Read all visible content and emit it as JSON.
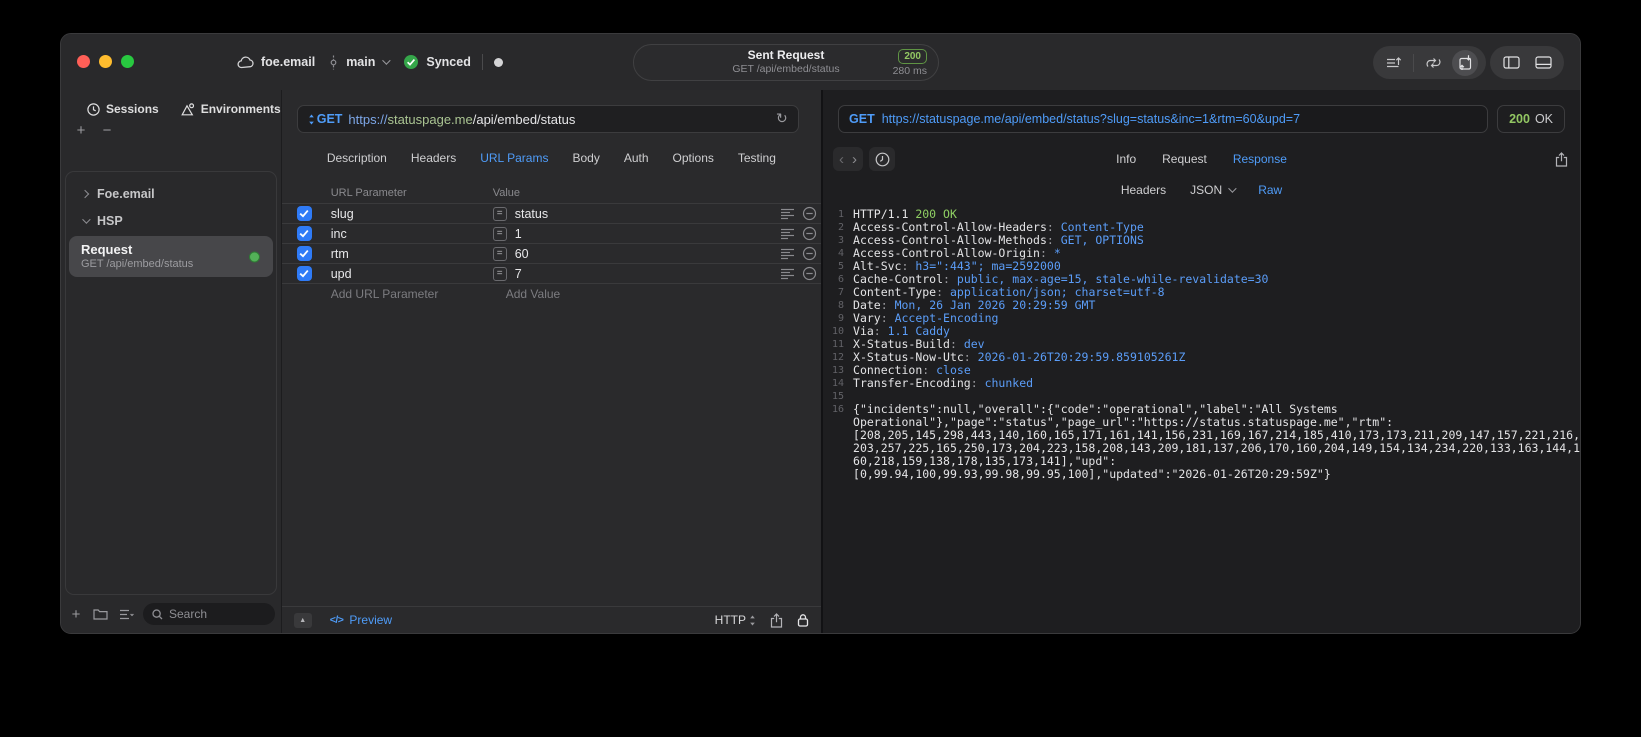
{
  "titlebar": {
    "project_name": "foe.email",
    "branch_name": "main",
    "sync_label": "Synced",
    "request_pill": {
      "title": "Sent Request",
      "subtitle": "GET /api/embed/status",
      "status_code": "200",
      "duration": "280 ms"
    }
  },
  "sidebar": {
    "tabs": [
      {
        "label": "Sessions",
        "icon": "clock-icon"
      },
      {
        "label": "Environments",
        "icon": "environments-icon"
      }
    ],
    "add_button": "+",
    "remove_button": "−",
    "tree": [
      {
        "label": "Foe.email",
        "expanded": false
      },
      {
        "label": "HSP",
        "expanded": true
      }
    ],
    "request_item": {
      "title": "Request",
      "subtitle": "GET /api/embed/status",
      "status_color": "#53b158"
    },
    "search": {
      "placeholder": "Search"
    }
  },
  "editor": {
    "method": "GET",
    "url": {
      "scheme": "https://",
      "host": "statuspage.me",
      "path": "/api/embed/status"
    },
    "tabs": [
      "Description",
      "Headers",
      "URL Params",
      "Body",
      "Auth",
      "Options",
      "Testing"
    ],
    "active_tab": "URL Params",
    "params": {
      "columns": [
        "URL Parameter",
        "Value"
      ],
      "rows": [
        {
          "checked": true,
          "name": "slug",
          "value": "status"
        },
        {
          "checked": true,
          "name": "inc",
          "value": "1"
        },
        {
          "checked": true,
          "name": "rtm",
          "value": "60"
        },
        {
          "checked": true,
          "name": "upd",
          "value": "7"
        }
      ],
      "add_row": {
        "name_placeholder": "Add URL Parameter",
        "value_placeholder": "Add Value"
      }
    },
    "footer": {
      "preview_label": "Preview",
      "code_glyph": "</>",
      "protocol": "HTTP"
    }
  },
  "response": {
    "request_line": {
      "method": "GET",
      "url": "https://statuspage.me/api/embed/status?slug=status&inc=1&rtm=60&upd=7"
    },
    "status": {
      "code": "200",
      "text": "OK"
    },
    "tabs": [
      "Info",
      "Request",
      "Response"
    ],
    "active_tab": "Response",
    "subtabs": [
      "Headers",
      "JSON",
      "Raw"
    ],
    "active_subtab": "Raw",
    "body_lines": [
      {
        "parts": [
          {
            "t": "HTTP/1.1 ",
            "s": "plain"
          },
          {
            "t": "200 OK",
            "s": "green"
          }
        ]
      },
      {
        "parts": [
          {
            "t": "Access-Control-Allow-Headers",
            "s": "plain"
          },
          {
            "t": ": ",
            "s": "muted"
          },
          {
            "t": "Content-Type",
            "s": "blue"
          }
        ]
      },
      {
        "parts": [
          {
            "t": "Access-Control-Allow-Methods",
            "s": "plain"
          },
          {
            "t": ": ",
            "s": "muted"
          },
          {
            "t": "GET, OPTIONS",
            "s": "blue"
          }
        ]
      },
      {
        "parts": [
          {
            "t": "Access-Control-Allow-Origin",
            "s": "plain"
          },
          {
            "t": ": ",
            "s": "muted"
          },
          {
            "t": "*",
            "s": "blue"
          }
        ]
      },
      {
        "parts": [
          {
            "t": "Alt-Svc",
            "s": "plain"
          },
          {
            "t": ": ",
            "s": "muted"
          },
          {
            "t": "h3=\":443\"; ma=2592000",
            "s": "blue"
          }
        ]
      },
      {
        "parts": [
          {
            "t": "Cache-Control",
            "s": "plain"
          },
          {
            "t": ": ",
            "s": "muted"
          },
          {
            "t": "public, max-age=15, stale-while-revalidate=30",
            "s": "blue"
          }
        ]
      },
      {
        "parts": [
          {
            "t": "Content-Type",
            "s": "plain"
          },
          {
            "t": ": ",
            "s": "muted"
          },
          {
            "t": "application/json; charset=utf-8",
            "s": "blue"
          }
        ]
      },
      {
        "parts": [
          {
            "t": "Date",
            "s": "plain"
          },
          {
            "t": ": ",
            "s": "muted"
          },
          {
            "t": "Mon, 26 Jan 2026 20:29:59 GMT",
            "s": "blue"
          }
        ]
      },
      {
        "parts": [
          {
            "t": "Vary",
            "s": "plain"
          },
          {
            "t": ": ",
            "s": "muted"
          },
          {
            "t": "Accept-Encoding",
            "s": "blue"
          }
        ]
      },
      {
        "parts": [
          {
            "t": "Via",
            "s": "plain"
          },
          {
            "t": ": ",
            "s": "muted"
          },
          {
            "t": "1.1 Caddy",
            "s": "blue"
          }
        ]
      },
      {
        "parts": [
          {
            "t": "X-Status-Build",
            "s": "plain"
          },
          {
            "t": ": ",
            "s": "muted"
          },
          {
            "t": "dev",
            "s": "blue"
          }
        ]
      },
      {
        "parts": [
          {
            "t": "X-Status-Now-Utc",
            "s": "plain"
          },
          {
            "t": ": ",
            "s": "muted"
          },
          {
            "t": "2026-01-26T20:29:59.859105261Z",
            "s": "blue"
          }
        ]
      },
      {
        "parts": [
          {
            "t": "Connection",
            "s": "plain"
          },
          {
            "t": ": ",
            "s": "muted"
          },
          {
            "t": "close",
            "s": "blue"
          }
        ]
      },
      {
        "parts": [
          {
            "t": "Transfer-Encoding",
            "s": "plain"
          },
          {
            "t": ": ",
            "s": "muted"
          },
          {
            "t": "chunked",
            "s": "blue"
          }
        ]
      },
      {
        "parts": []
      },
      {
        "rows": [
          "{\"incidents\":null,\"overall\":{\"code\":\"operational\",\"label\":\"All Systems",
          "Operational\"},\"page\":\"status\",\"page_url\":\"https://status.statuspage.me\",\"rtm\":",
          "[208,205,145,298,443,140,160,165,171,161,141,156,231,169,167,214,185,410,173,173,211,209,147,157,221,216,",
          "203,257,225,165,250,173,204,223,158,208,143,209,181,137,206,170,160,204,149,154,134,234,220,133,163,144,1",
          "60,218,159,138,178,135,173,141],\"upd\":",
          "[0,99.94,100,99.93,99.98,99.95,100],\"updated\":\"2026-01-26T20:29:59Z\"}"
        ]
      }
    ]
  },
  "colors": {
    "accent_blue": "#4f9cf8",
    "status_green": "#93c763",
    "checkbox_blue": "#2f7bf7",
    "request_dot_green": "#53b158"
  }
}
